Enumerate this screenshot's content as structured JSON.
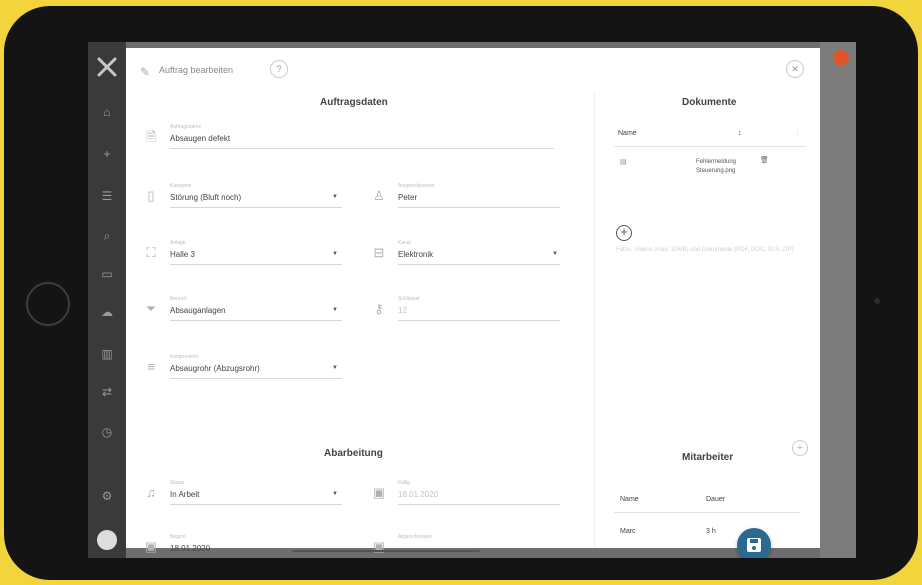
{
  "dialog": {
    "title": "Auftrag bearbeiten",
    "title_icon": "edit-icon",
    "help_icon": "question-icon",
    "close_icon": "close-icon"
  },
  "sidebar": {
    "icons": [
      "home-icon",
      "plus-icon",
      "list-icon",
      "search-icon",
      "monitor-icon",
      "cloud-icon",
      "chart-icon",
      "swap-icon",
      "clock-icon",
      "gear-icon"
    ]
  },
  "auftragsdaten": {
    "title": "Auftragsdaten",
    "fields": {
      "auftragsname": {
        "label": "Auftragsname",
        "value": "Absaugen defekt"
      },
      "kategorie": {
        "label": "Kategorie",
        "value": "Störung (Bluft noch)"
      },
      "kunde": {
        "label": "Ansprechpartner",
        "value": "Peter"
      },
      "anlage": {
        "label": "Anlage",
        "value": "Halle 3"
      },
      "kanal": {
        "label": "Kanal",
        "value": "Elektronik"
      },
      "bereich": {
        "label": "Bereich",
        "value": "Absauganlagen"
      },
      "schluessel": {
        "label": "Schlüssel",
        "value": "12"
      },
      "komponente": {
        "label": "Komponente",
        "value": "Absaugrohr (Abzugsrohr)"
      }
    }
  },
  "dokumente": {
    "title": "Dokumente",
    "col_name": "Name",
    "col_sort": "↕",
    "file_name": "Fehlermeldung Steuerung.png",
    "hint": "Fotos, Videos (max. 10MB) und Dokumente (PDF, DOC, XLS, ZIP)"
  },
  "abarbeitung": {
    "title": "Abarbeitung",
    "fields": {
      "status": {
        "label": "Status",
        "value": "In Arbeit"
      },
      "beginn": {
        "label": "Beginn",
        "value": "18.01.2020"
      },
      "faellig": {
        "label": "Fällig",
        "value": "18.01.2020"
      },
      "abgeschlossen": {
        "label": "Abgeschlossen",
        "value": ""
      }
    }
  },
  "mitarbeiter": {
    "title": "Mitarbeiter",
    "col_name": "Name",
    "col_dauer": "Dauer",
    "rows": [
      {
        "name": "Marc",
        "dauer": "3 h"
      }
    ]
  },
  "save_button": {
    "icon": "save-icon"
  },
  "colors": {
    "accent": "#2a6a92",
    "background": "#f2d43c",
    "device": "#141414",
    "avatar": "#e0542c"
  }
}
